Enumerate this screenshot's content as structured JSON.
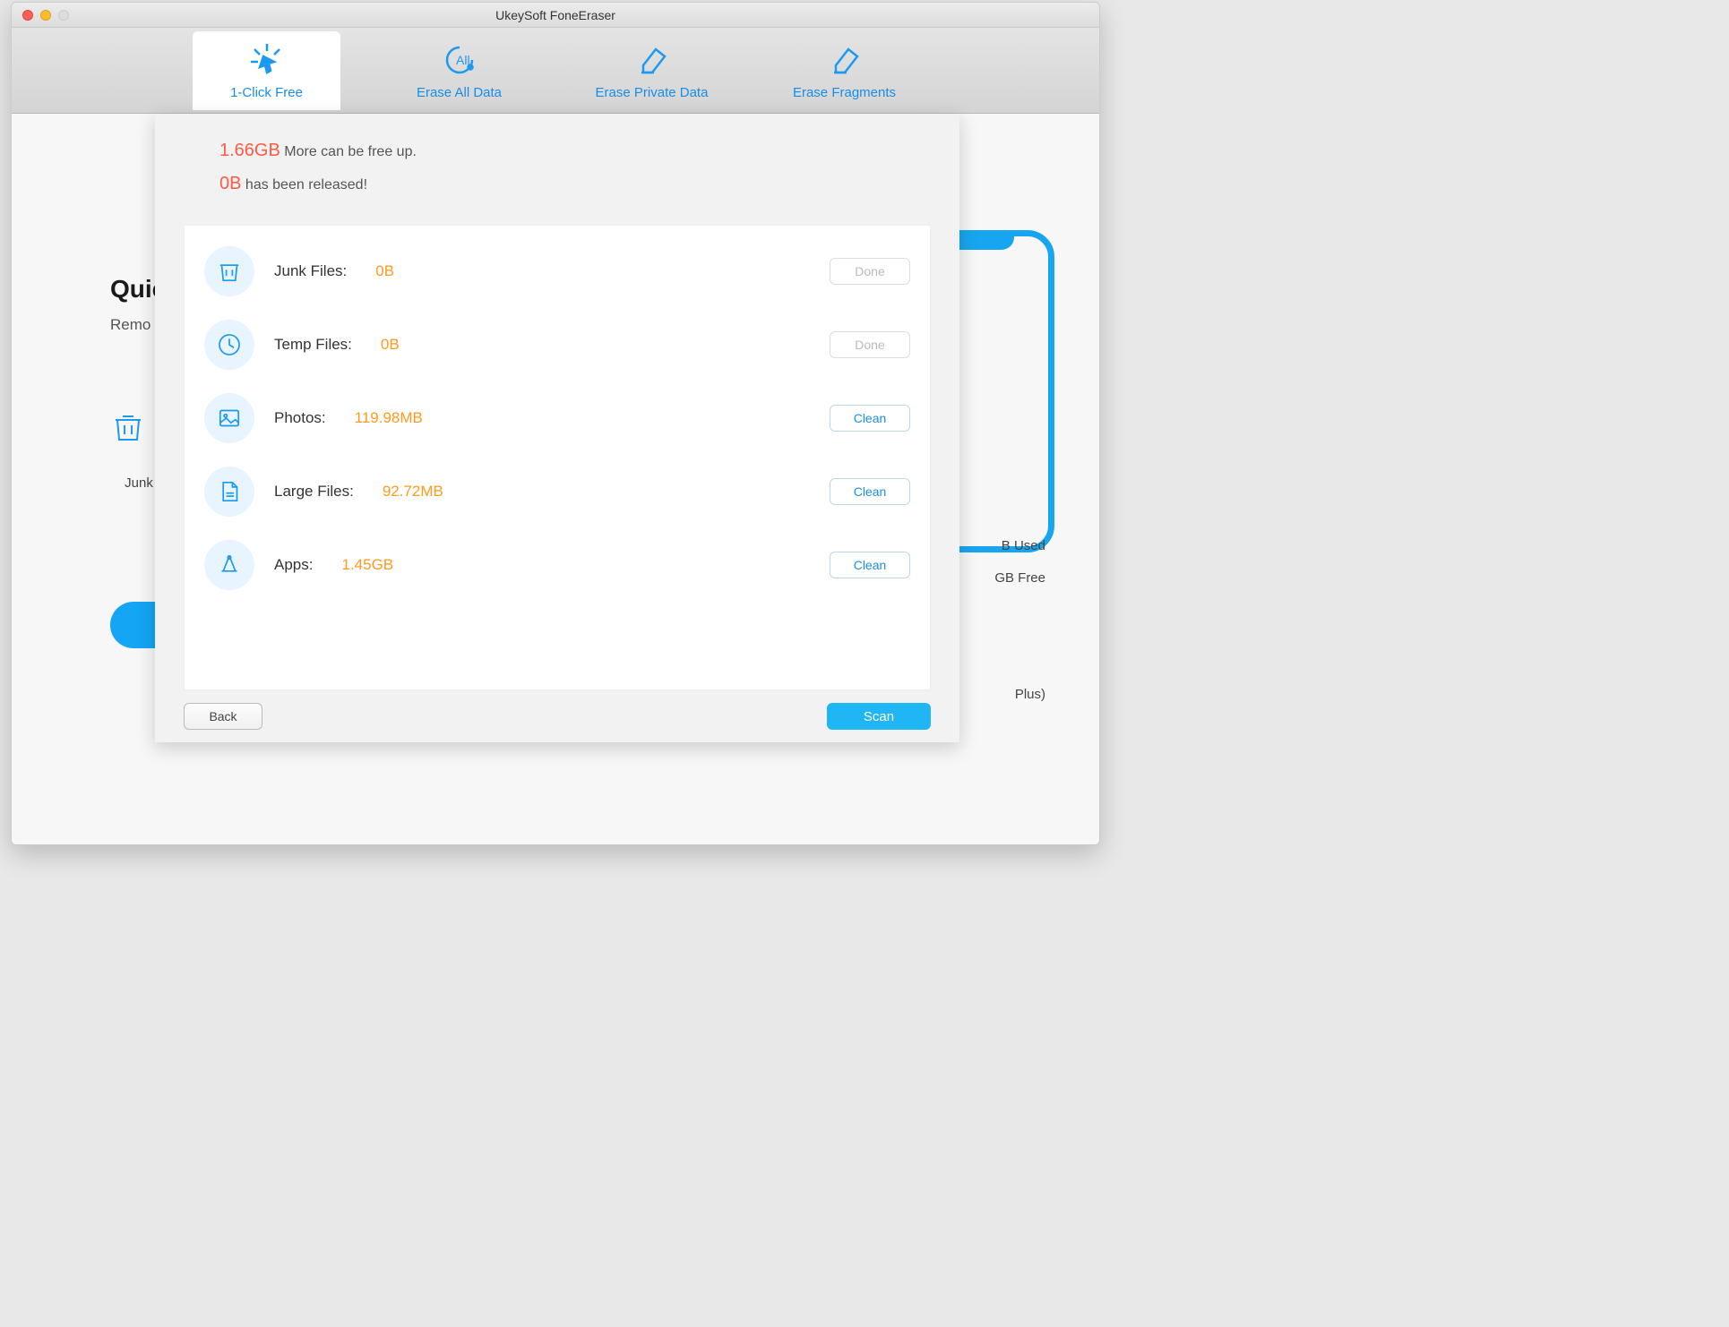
{
  "window": {
    "title": "UkeySoft FoneEraser"
  },
  "tabs": [
    {
      "label": "1-Click Free"
    },
    {
      "label": "Erase All Data"
    },
    {
      "label": "Erase Private Data"
    },
    {
      "label": "Erase Fragments"
    }
  ],
  "summary": {
    "free_amount": "1.66GB",
    "free_suffix": " More can be free up.",
    "released_amount": "0B",
    "released_suffix": " has been released!"
  },
  "categories": [
    {
      "label": "Junk Files:",
      "value": "0B",
      "action": "Done",
      "action_type": "done"
    },
    {
      "label": "Temp Files:",
      "value": "0B",
      "action": "Done",
      "action_type": "done"
    },
    {
      "label": "Photos:",
      "value": "119.98MB",
      "action": "Clean",
      "action_type": "clean"
    },
    {
      "label": "Large Files:",
      "value": "92.72MB",
      "action": "Clean",
      "action_type": "clean"
    },
    {
      "label": "Apps:",
      "value": "1.45GB",
      "action": "Clean",
      "action_type": "clean"
    }
  ],
  "footer": {
    "back": "Back",
    "scan": "Scan"
  },
  "background": {
    "heading": "Quic",
    "subtitle": "Remo",
    "junk_label": "Junk",
    "stat_used_suffix": "B Used",
    "stat_free_suffix": "GB Free",
    "model_suffix": " Plus)"
  }
}
